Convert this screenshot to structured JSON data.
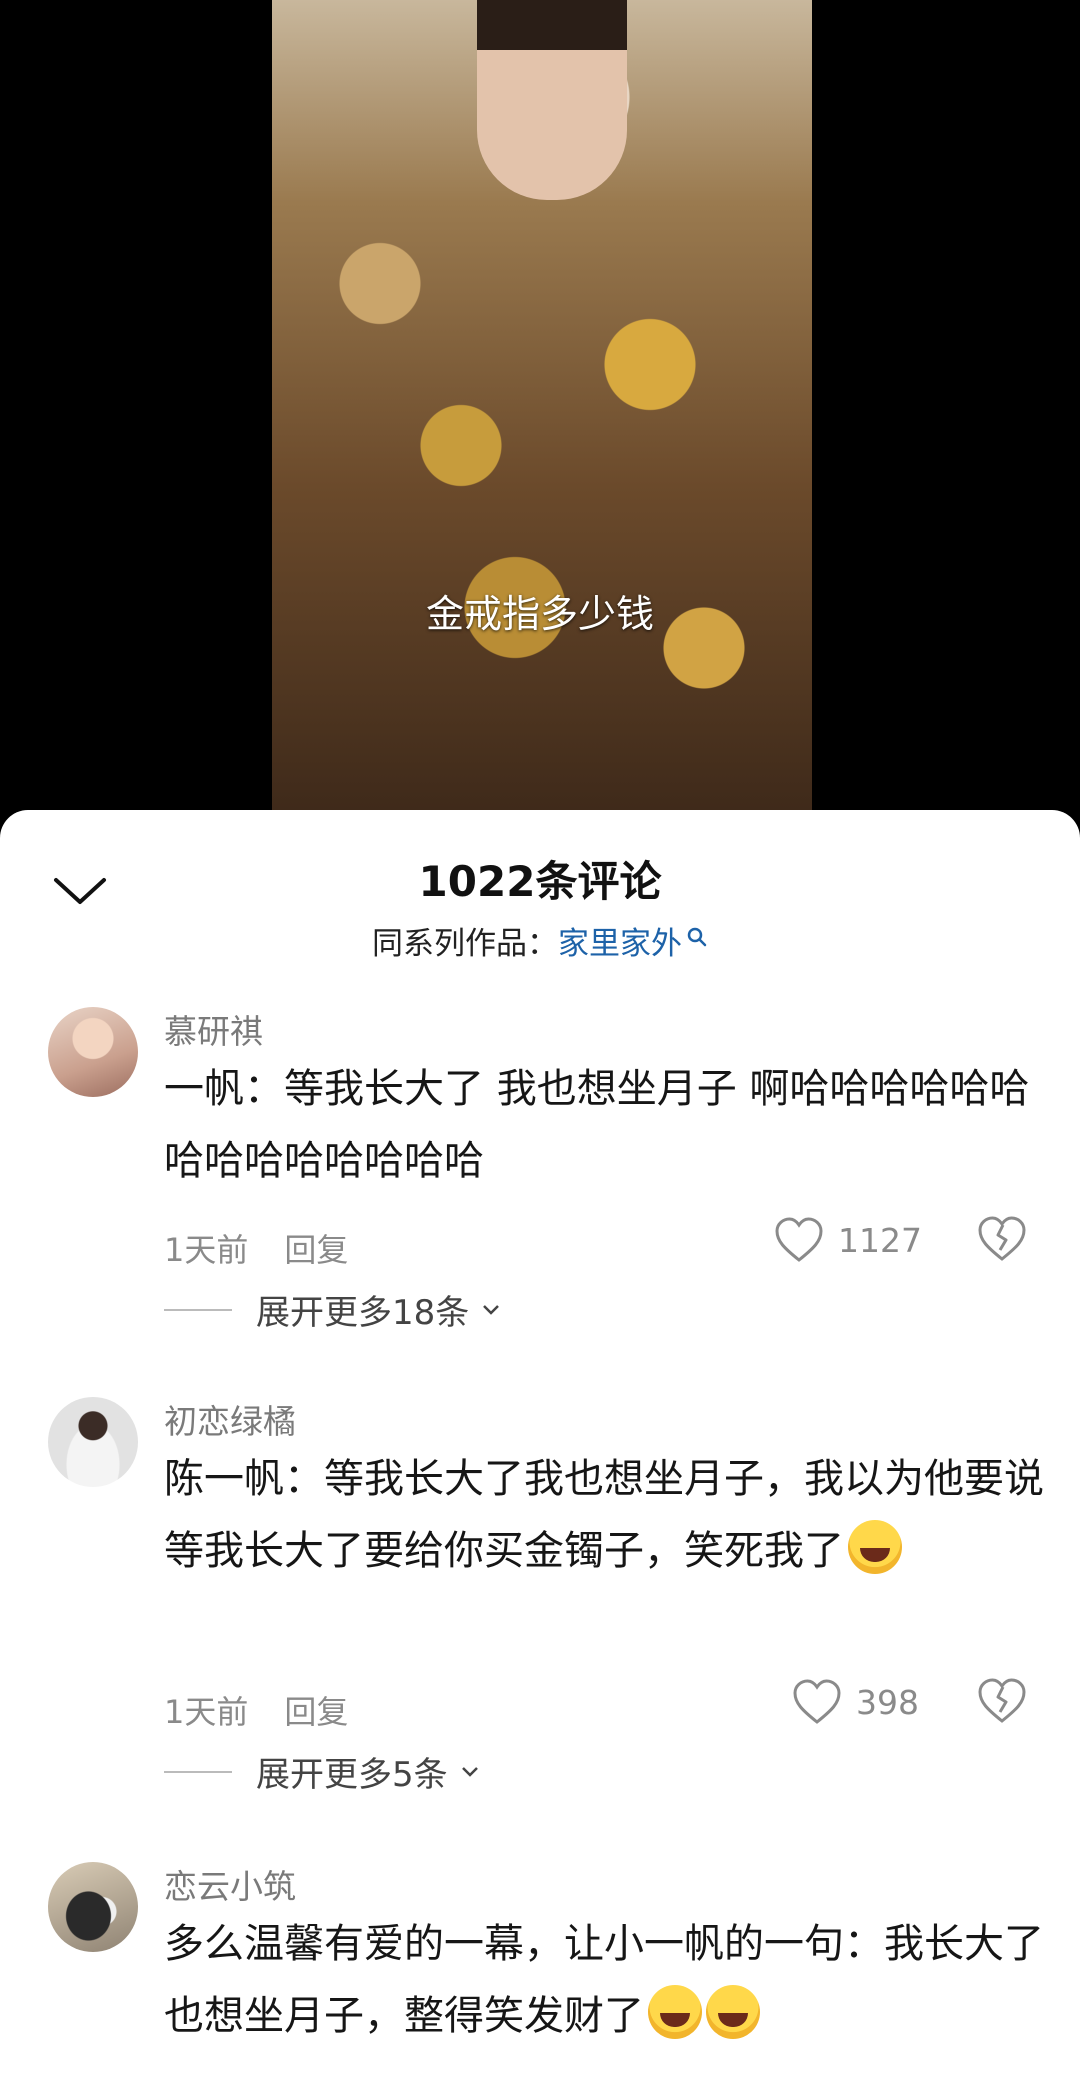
{
  "video": {
    "subtitle": "金戒指多少钱"
  },
  "comments_panel": {
    "title": "1022条评论",
    "series_label": "同系列作品：",
    "series_link": "家里家外",
    "comments": [
      {
        "username": "慕研祺",
        "text": "一帆：等我长大了  我也想坐月子 啊哈哈哈哈哈哈哈哈哈哈哈哈哈哈",
        "time": "1天前",
        "reply": "回复",
        "likes": "1127",
        "expand": "展开更多18条"
      },
      {
        "username": "初恋绿橘",
        "text": "陈一帆：等我长大了我也想坐月子，我以为他要说等我长大了要给你买金镯子，笑死我了",
        "time": "1天前",
        "reply": "回复",
        "likes": "398",
        "expand": "展开更多5条"
      },
      {
        "username": "恋云小筑",
        "text": "多么温馨有爱的一幕，让小一帆的一句：我长大了也想坐月子，整得笑发财了"
      }
    ]
  }
}
